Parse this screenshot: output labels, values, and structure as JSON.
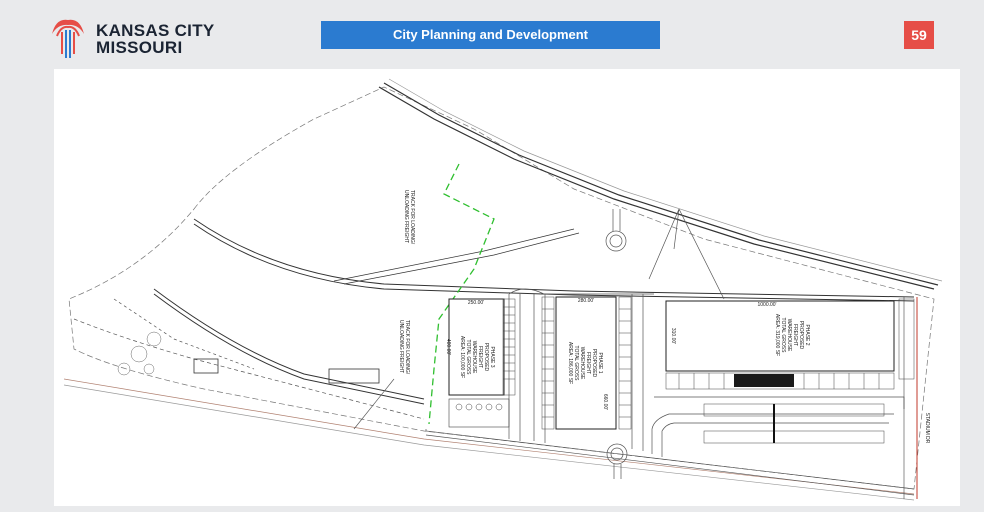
{
  "header": {
    "brand_line1": "KANSAS CITY",
    "brand_line2": "MISSOURI",
    "banner_title": "City Planning and Development",
    "page_number": "59"
  },
  "site_plan": {
    "phase3": [
      "PHASE 3",
      "PROPOSED",
      "FREIGHT",
      "WAREHOUSE",
      "TOTAL GROSS",
      "AREA: 100,000 SF"
    ],
    "phase1": [
      "PHASE 1",
      "PROPOSED",
      "FREIGHT",
      "WAREHOUSE",
      "TOTAL GROSS",
      "AREA: 186,000 SF"
    ],
    "phase2": [
      "PHASE 2",
      "PROPOSED",
      "FREIGHT",
      "WAREHOUSE",
      "TOTAL GROSS",
      "AREA: 319,000 SF"
    ],
    "track_note_1": [
      "TRACK FOR LOADING/",
      "UNLOADING FREIGHT"
    ],
    "track_note_2": [
      "TRACK FOR LOADING/",
      "UNLOADING FREIGHT"
    ],
    "dim_phase3_top": "250.00'",
    "dim_phase3_side": "400.00'",
    "dim_phase1_top": "280.00'",
    "dim_phase1_side": "660.00'",
    "dim_phase2_top": "1000.00'",
    "dim_phase2_side": "310.00'",
    "street_label": "STADIUM DR"
  }
}
